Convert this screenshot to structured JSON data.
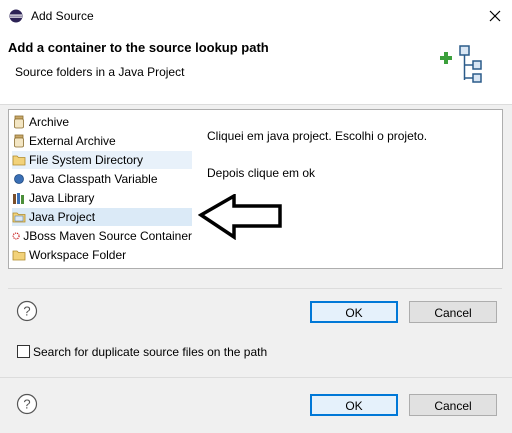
{
  "window": {
    "title": "Add Source"
  },
  "header": {
    "title": "Add a container to the source lookup path",
    "description": "Source folders in a Java Project"
  },
  "list": {
    "items": [
      {
        "label": "Archive",
        "icon": "archive-jar-icon",
        "selected": false
      },
      {
        "label": "External Archive",
        "icon": "archive-jar-icon",
        "selected": false
      },
      {
        "label": "File System Directory",
        "icon": "folder-icon",
        "selected": false,
        "highlight": true
      },
      {
        "label": "Java Classpath Variable",
        "icon": "variable-dot-icon",
        "selected": false
      },
      {
        "label": "Java Library",
        "icon": "library-books-icon",
        "selected": false
      },
      {
        "label": "Java Project",
        "icon": "project-folder-icon",
        "selected": true
      },
      {
        "label": "JBoss Maven Source Container",
        "icon": "jboss-ring-icon",
        "selected": false
      },
      {
        "label": "Workspace Folder",
        "icon": "folder-icon",
        "selected": false
      }
    ]
  },
  "notes": {
    "line1": "Cliquei em java project. Escolhi o projeto.",
    "line2": "Depois clique em  ok"
  },
  "inner_buttons": {
    "ok": "OK",
    "cancel": "Cancel"
  },
  "checkbox": {
    "label": "Search for duplicate source files on the path",
    "checked": false
  },
  "outer_buttons": {
    "ok": "OK",
    "cancel": "Cancel"
  },
  "colors": {
    "selection": "#dbeaf7",
    "default_button_border": "#0078d7"
  }
}
